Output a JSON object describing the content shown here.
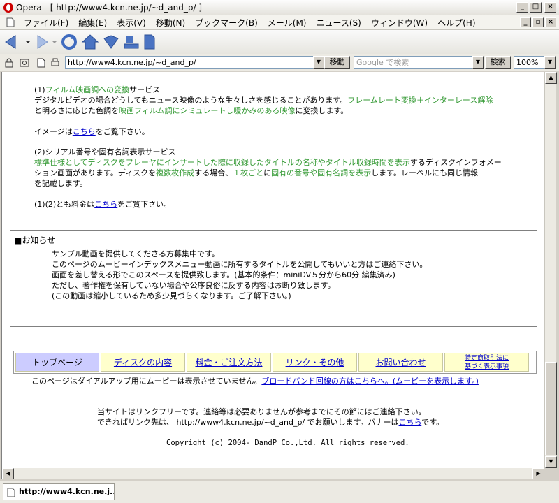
{
  "window": {
    "title": "Opera - [ http://www4.kcn.ne.jp/~d_and_p/ ]"
  },
  "menu": [
    "ファイル(F)",
    "編集(E)",
    "表示(V)",
    "移動(N)",
    "ブックマーク(B)",
    "メール(M)",
    "ニュース(S)",
    "ウィンドウ(W)",
    "ヘルプ(H)"
  ],
  "address": {
    "url": "http://www4.kcn.ne.jp/~d_and_p/",
    "go_label": "移動",
    "search_placeholder": "Google で検索",
    "search_label": "検索",
    "zoom": "100%"
  },
  "content": {
    "s1_a": "(1)",
    "s1_b": "フィルム映画調への変換",
    "s1_c": "サービス",
    "s1_l2a": "デジタルビデオの場合どうしてもニュース映像のような生々しさを感じることがあります。",
    "s1_l2b": "フレームレート変換＋インターレース解除",
    "s1_l3a": "と明るさに応じた色調を",
    "s1_l3b": "映画フィルム調にシミュレートし暖かみのある映像",
    "s1_l3c": "に変換します。",
    "img_a": "イメージは",
    "img_link": "こちら",
    "img_b": "をご覧下さい。",
    "s2_title": "(2)シリアル番号や固有名詞表示サービス",
    "s2_l1a": "標準仕様としてディスクをプレーヤにインサートした際に",
    "s2_l1b": "収録したタイトルの名称やタイトル収録時間を表示",
    "s2_l1c": "するディスクインフォメー",
    "s2_l2a": "ション画面があります。ディスクを",
    "s2_l2b": "複数枚作成",
    "s2_l2c": "する場合、",
    "s2_l2d": "１枚ごと",
    "s2_l2e": "に",
    "s2_l2f": "固有の番号や固有名詞を表示",
    "s2_l2g": "します。レーベルにも同じ情報",
    "s2_l3": "を記載します。",
    "price_a": "(1)(2)とも料金は",
    "price_link": "こちら",
    "price_b": "をご覧下さい。",
    "notice_title": "■お知らせ",
    "notice_lines": [
      "サンプル動画を提供してくださる方募集中です。",
      "このページのムービーインデックスメニュー動画に所有するタイトルを公開してもいいと方はご連絡下さい。",
      "画面を差し替える形でこのスペースを提供致します。(基本的条件：miniDV５分から60分 編集済み)",
      "ただし、著作権を保有していない場合や公序良俗に反する内容はお断り致します。",
      "(この動画は縮小しているため多少見づらくなります。ご了解下さい。)"
    ],
    "nav": [
      "トップページ",
      "ディスクの内容",
      "料金・ご注文方法",
      "リンク・その他",
      "お問い合わせ",
      "特定商取引法に",
      "基づく表示事項"
    ],
    "dialup_a": "このページはダイアルアップ用にムービーは表示させていません。",
    "dialup_link": "ブロードバンド回線の方はこちらへ。(ムービーを表示します。)",
    "free_line": "当サイトはリンクフリーです。連絡等は必要ありませんが参考までにその節にはご連絡下さい。",
    "link_a": "できればリンク先は、 http://www4.kcn.ne.jp/~d_and_p/ でお願いします。バナーは",
    "link_link": "こちら",
    "link_b": "です。",
    "copyright": "Copyright (c) 2004- DandP Co.,Ltd. All rights reserved."
  },
  "status": {
    "tab_title": "http://www4.kcn.ne.j..."
  },
  "colors": {
    "accent_green": "#339933",
    "link_blue": "#0000cc",
    "nav_cell": "#ffffcc",
    "nav_active": "#ccccff"
  }
}
